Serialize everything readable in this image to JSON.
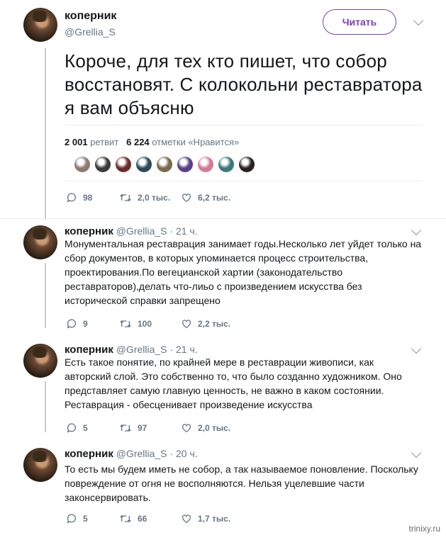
{
  "main_tweet": {
    "name": "коперник",
    "handle": "@Grellia_S",
    "follow_label": "Читать",
    "text": "Короче, для тех кто пишет, что собор восстановят. С колокольни реставратора я вам объясню",
    "retweets_count": "2 001",
    "retweets_label": "ретвит",
    "likes_count": "6 224",
    "likes_label": "отметки «Нравится»",
    "replies": "98",
    "retweets_short": "2,0 тыс.",
    "likes_short": "6,2 тыс.",
    "liker_colors": [
      "#8a7b6e",
      "#3b3b3b",
      "#6b2d2d",
      "#2d4a5a",
      "#7a6a4a",
      "#5a3f8a",
      "#d27a9a",
      "#3a7a7a",
      "#2a2222"
    ]
  },
  "replies": [
    {
      "name": "коперник",
      "handle": "@Grellia_S",
      "time": "· 21 ч.",
      "text": "Монументальная реставрация занимает годы.Несколько лет уйдет только на сбор документов, в которых упоминается процесс строительства, проектирования.По вегецианской хартии (законодательство реставраторов),делать что-лиьо с произведением искусства без исторической справки запрещено",
      "replies": "9",
      "retweets": "100",
      "likes": "2,2 тыс."
    },
    {
      "name": "коперник",
      "handle": "@Grellia_S",
      "time": "· 21 ч.",
      "text": "Есть такое понятие, по крайней мере в реставрации живописи, как авторский слой. Это собственно то, что было созданно художником. Оно представляет самую главную ценность, не важно в каком состоянии. Реставрация - обесценивает произведение искусства",
      "replies": "5",
      "retweets": "97",
      "likes": "2,0 тыс."
    },
    {
      "name": "коперник",
      "handle": "@Grellia_S",
      "time": "· 20 ч.",
      "text": "То есть мы будем иметь не собор, а так называемое поновление. Поскольку повреждение от огня не восполняются. Нельзя уцелевшие части законсервировать.",
      "replies": "5",
      "retweets": "66",
      "likes": "1,7 тыс."
    }
  ],
  "watermark": "trinixy.ru"
}
